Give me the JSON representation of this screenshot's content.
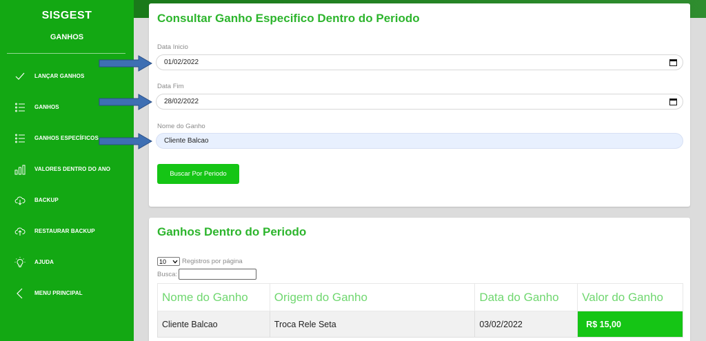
{
  "sidebar": {
    "brand": "SISGEST",
    "section": "GANHOS",
    "items": [
      {
        "label": "LANÇAR GANHOS",
        "icon": "check-icon"
      },
      {
        "label": "GANHOS",
        "icon": "list-icon"
      },
      {
        "label": "GANHOS ESPECÍFICOS",
        "icon": "list-icon"
      },
      {
        "label": "VALORES DENTRO DO ANO",
        "icon": "bar-chart-icon"
      },
      {
        "label": "BACKUP",
        "icon": "cloud-download-icon"
      },
      {
        "label": "RESTAURAR BACKUP",
        "icon": "cloud-upload-icon"
      },
      {
        "label": "AJUDA",
        "icon": "lightbulb-icon"
      },
      {
        "label": "MENU PRINCIPAL",
        "icon": "chevron-left-icon"
      }
    ]
  },
  "form": {
    "title": "Consultar Ganho Especifico Dentro do Periodo",
    "start_label": "Data Inicio",
    "start_value": "01/02/2022",
    "end_label": "Data Fim",
    "end_value": "28/02/2022",
    "name_label": "Nome do Ganho",
    "name_value": "Cliente Balcao",
    "search_button": "Buscar Por Periodo"
  },
  "results": {
    "title": "Ganhos Dentro do Periodo",
    "page_size": "10",
    "page_size_label": "Registros por página",
    "search_label": "Busca:",
    "columns": [
      "Nome do Ganho",
      "Origem do Ganho",
      "Data do Ganho",
      "Valor do Ganho"
    ],
    "rows": [
      {
        "name": "Cliente Balcao",
        "origin": "Troca Rele Seta",
        "date": "03/02/2022",
        "value": "R$ 15,00"
      }
    ]
  },
  "colors": {
    "sidebar": "#13a813",
    "accent": "#2db52d",
    "button": "#15c515",
    "arrow": "#3e6fb3"
  }
}
